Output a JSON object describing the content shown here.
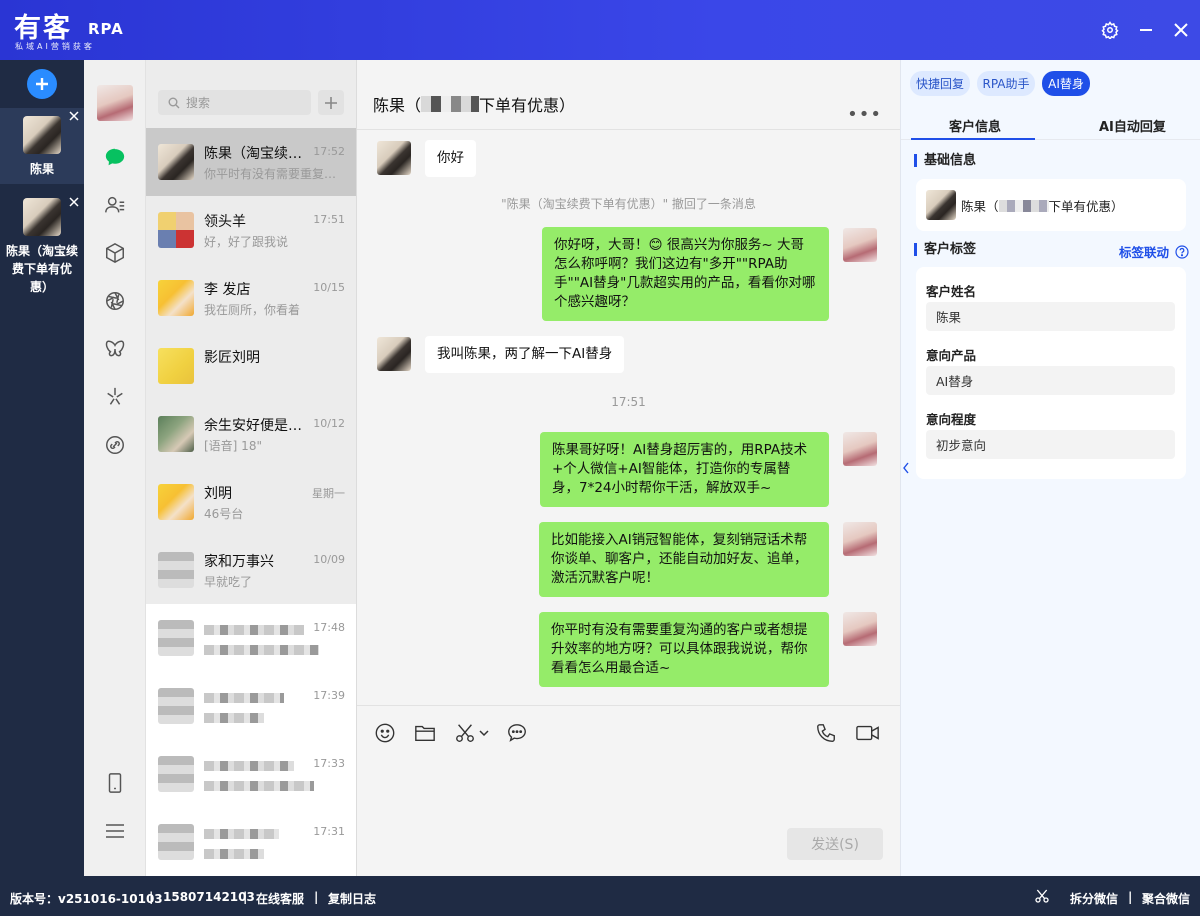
{
  "app": {
    "title": "有客",
    "rpa": "RPA",
    "subtitle": "私域AI营销获客"
  },
  "accounts": [
    {
      "name": "陈果"
    },
    {
      "name": "陈果（淘宝续费下单有优惠）"
    }
  ],
  "search": {
    "placeholder": "搜索"
  },
  "conversations": [
    {
      "name": "陈果（淘宝续费下单有优惠）",
      "time": "17:52",
      "preview": "你平时有没有需要重复沟通的客户或者想提升效率的地方呀"
    },
    {
      "name": "领头羊",
      "time": "17:51",
      "preview": "好，好了跟我说"
    },
    {
      "name": "李 发店",
      "time": "10/15",
      "preview": "我在厕所，你看着"
    },
    {
      "name": "影匠刘明",
      "time": "",
      "preview": ""
    },
    {
      "name": "余生安好便是晴天",
      "time": "10/12",
      "preview": "[语音] 18\""
    },
    {
      "name": "刘明",
      "time": "星期一",
      "preview": "46号台"
    },
    {
      "name": "家和万事兴",
      "time": "10/09",
      "preview": "早就吃了"
    },
    {
      "name": "",
      "time": "17:48",
      "preview": ""
    },
    {
      "name": "",
      "time": "17:39",
      "preview": ""
    },
    {
      "name": "",
      "time": "17:33",
      "preview": ""
    },
    {
      "name": "",
      "time": "17:31",
      "preview": ""
    }
  ],
  "chat": {
    "title_prefix": "陈果（",
    "title_suffix": "下单有优惠）",
    "more": "•••",
    "messages": [
      {
        "text": "你好"
      },
      {
        "text": "\"陈果（淘宝续费下单有优惠）\" 撤回了一条消息"
      },
      {
        "text": "你好呀，大哥！😊 很高兴为你服务~ 大哥怎么称呼啊？我们这边有\"多开\"\"RPA助手\"\"AI替身\"几款超实用的产品，看看你对哪个感兴趣呀？"
      },
      {
        "text": "我叫陈果，两了解一下AI替身"
      },
      {
        "text": "17:51"
      },
      {
        "text": "陈果哥好呀！AI替身超厉害的，用RPA技术+个人微信+AI智能体，打造你的专属替身，7*24小时帮你干活，解放双手~"
      },
      {
        "text": "比如能接入AI销冠智能体，复刻销冠话术帮你谈单、聊客户，还能自动加好友、追单，激活沉默客户呢！"
      },
      {
        "text": "你平时有没有需要重复沟通的客户或者想提升效率的地方呀？可以具体跟我说说，帮你看看怎么用最合适~"
      }
    ],
    "send_label": "发送(S)"
  },
  "panel": {
    "tabs": [
      "快捷回复",
      "RPA助手",
      "AI替身"
    ],
    "subtabs": [
      "客户信息",
      "AI自动回复"
    ],
    "basic_title": "基础信息",
    "basic_name_prefix": "陈果（",
    "basic_name_suffix": "下单有优惠）",
    "tag_title": "客户标签",
    "tag_link": "标签联动",
    "fields": [
      {
        "label": "客户姓名",
        "value": "陈果"
      },
      {
        "label": "意向产品",
        "value": "AI替身"
      },
      {
        "label": "意向程度",
        "value": "初步意向"
      }
    ]
  },
  "footer": {
    "version": "版本号：v251016-10103",
    "phone": "15807142103",
    "service": "在线客服",
    "copy_log": "复制日志",
    "split": "拆分微信",
    "merge": "聚合微信",
    "sep": "|"
  }
}
